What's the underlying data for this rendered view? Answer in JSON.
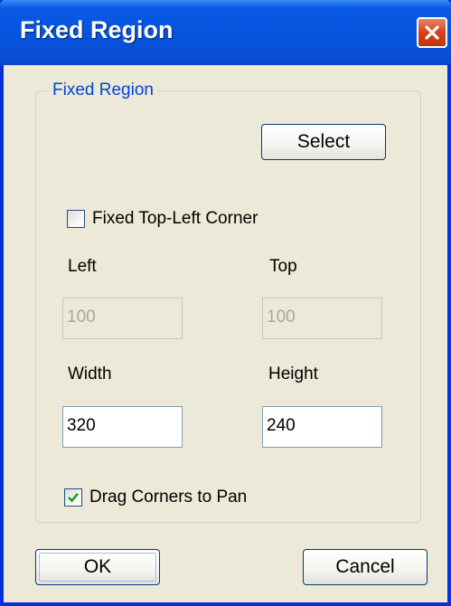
{
  "window": {
    "title": "Fixed Region",
    "close_icon": "close-icon",
    "colors": {
      "titlebar": "#0653e0",
      "close": "#d3421c",
      "face": "#ece9d8",
      "group_label": "#0046d5"
    }
  },
  "group": {
    "label": "Fixed Region",
    "select_label": "Select",
    "fixed_corner": {
      "label": "Fixed Top-Left Corner",
      "checked": false
    },
    "left": {
      "label": "Left",
      "value": "100",
      "enabled": false
    },
    "top": {
      "label": "Top",
      "value": "100",
      "enabled": false
    },
    "width": {
      "label": "Width",
      "value": "320",
      "enabled": true
    },
    "height": {
      "label": "Height",
      "value": "240",
      "enabled": true
    },
    "drag_corners": {
      "label": "Drag Corners to Pan",
      "checked": true
    }
  },
  "buttons": {
    "ok_label": "OK",
    "cancel_label": "Cancel"
  }
}
